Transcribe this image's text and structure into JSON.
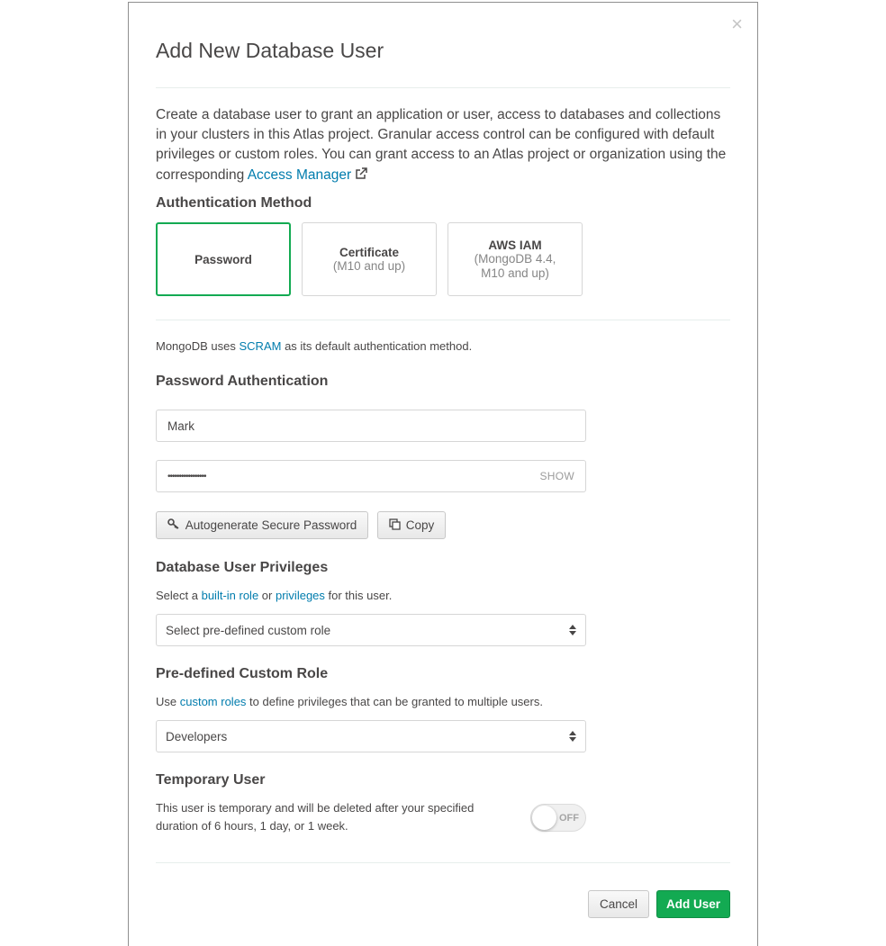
{
  "modal": {
    "title": "Add New Database User",
    "close_icon": "×",
    "intro": {
      "text1": "Create a database user to grant an application or user, access to databases and collections in your clusters in this Atlas project. Granular access control can be configured with default privileges or custom roles. You can grant access to an Atlas project or organization using the corresponding ",
      "link": "Access Manager",
      "icon": "external-link-icon"
    }
  },
  "auth": {
    "label": "Authentication Method",
    "options": [
      {
        "name": "Password",
        "sub": "",
        "selected": true
      },
      {
        "name": "Certificate",
        "sub": "(M10 and up)",
        "selected": false
      },
      {
        "name": "AWS IAM",
        "sub": "(MongoDB 4.4, M10 and up)",
        "selected": false
      }
    ],
    "note_pre": "MongoDB uses ",
    "note_link": "SCRAM",
    "note_post": " as its default authentication method."
  },
  "password_auth": {
    "label": "Password Authentication",
    "username_value": "Mark",
    "password_mask": "•••••••••••••••••",
    "show_label": "SHOW",
    "autogen_label": "Autogenerate Secure Password",
    "copy_label": "Copy"
  },
  "privileges": {
    "label": "Database User Privileges",
    "desc_pre": "Select a ",
    "desc_link1": "built-in role",
    "desc_mid": " or ",
    "desc_link2": "privileges",
    "desc_post": " for this user.",
    "select_value": "Select pre-defined custom role"
  },
  "custom_role": {
    "label": "Pre-defined Custom Role",
    "desc_pre": "Use ",
    "desc_link": "custom roles",
    "desc_post": " to define privileges that can be granted to multiple users.",
    "select_value": "Developers"
  },
  "temporary": {
    "label": "Temporary User",
    "desc": "This user is temporary and will be deleted after your specified duration of 6 hours, 1 day, or 1 week.",
    "toggle_label": "OFF",
    "enabled": false
  },
  "footer": {
    "cancel_label": "Cancel",
    "add_label": "Add User"
  },
  "colors": {
    "accent_green": "#13aa52",
    "link_blue": "#007cad"
  }
}
